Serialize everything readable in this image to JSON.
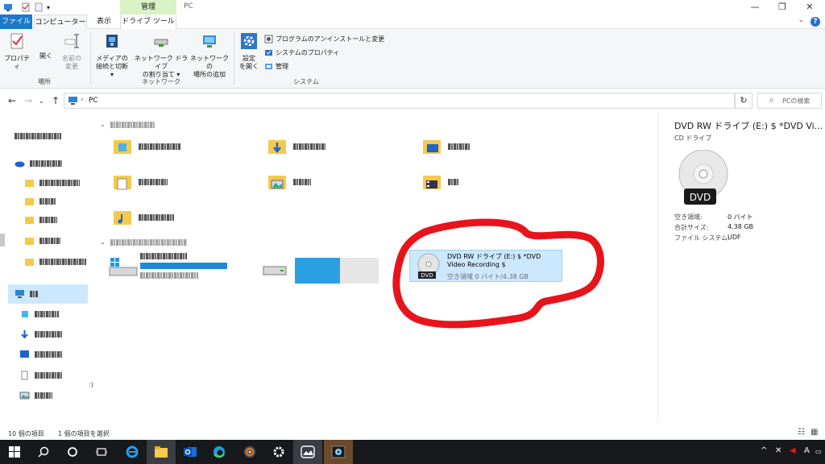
{
  "titlebar": {
    "manage_tab": "管理",
    "window_title": "PC",
    "minimize": "—",
    "maximize": "❐",
    "close": "✕"
  },
  "tabs": {
    "file": "ファイル",
    "computer": "コンピューター",
    "view": "表示",
    "drive_tools": "ドライブ ツール"
  },
  "ribbon": {
    "properties": "プロパティ",
    "open": "開く",
    "rename": [
      "名前の",
      "変更"
    ],
    "group_location": "場所",
    "media": [
      "メディアの",
      "接続と切断 ▾"
    ],
    "map_drive": [
      "ネットワーク ドライブ",
      "の割り当て ▾"
    ],
    "add_location": [
      "ネットワークの",
      "場所の追加"
    ],
    "group_network": "ネットワーク",
    "settings": [
      "設定",
      "を開く"
    ],
    "uninstall": "プログラムのアンインストールと変更",
    "sys_props": "システムのプロパティ",
    "manage": "管理",
    "group_system": "システム"
  },
  "address": {
    "path": "PC",
    "search_placeholder": "PCの検索"
  },
  "content": {
    "dvd_name": "DVD RW ドライブ (E:) $ *DVD Video Recording $",
    "dvd_space": "空き領域 0 バイト/4.38 GB",
    "dvd_badge": "DVD"
  },
  "details": {
    "title": "DVD RW ドライブ (E:) $ *DVD Vi...",
    "subtitle": "CD ドライブ",
    "badge": "DVD",
    "props": [
      {
        "label": "空き領域:",
        "value": "0 バイト"
      },
      {
        "label": "合計サイズ:",
        "value": "4.38 GB"
      },
      {
        "label": "ファイル システム:",
        "value": "UDF"
      }
    ]
  },
  "status": {
    "count": "10 個の項目",
    "selected": "1 個の項目を選択"
  },
  "colors": {
    "accent": "#1979ca",
    "selection": "#cce8ff",
    "annotation": "#e8141c",
    "taskbar": "#17191c"
  }
}
